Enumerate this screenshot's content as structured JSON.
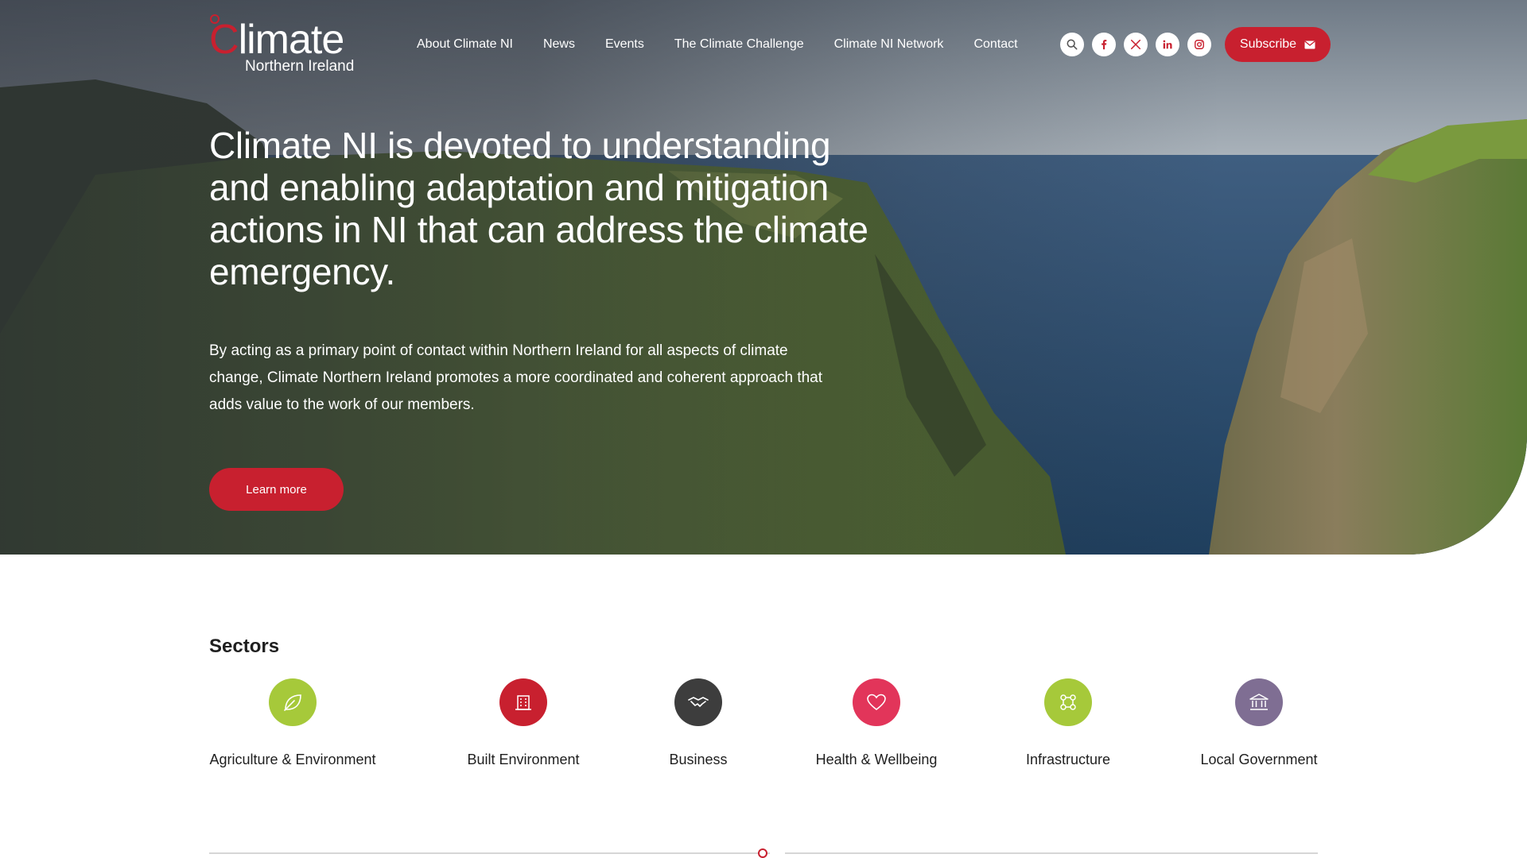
{
  "header": {
    "logo": {
      "main": "Climate",
      "sub": "Northern Ireland"
    },
    "nav": [
      "About Climate NI",
      "News",
      "Events",
      "The Climate Challenge",
      "Climate NI Network",
      "Contact"
    ],
    "icons": [
      "search-icon",
      "facebook-icon",
      "x-icon",
      "linkedin-icon",
      "instagram-icon"
    ],
    "subscribe_label": "Subscribe",
    "subscribe_icon": "envelope-icon"
  },
  "hero": {
    "headline": "Climate NI is devoted to understanding and enabling adaptation and mitigation actions in NI that can address the climate emergency.",
    "lead": "By acting as a primary point of contact within Northern Ireland for all aspects of climate change, Climate Northern Ireland promotes a more coordinated and coherent approach that adds value to the work of our members.",
    "cta_label": "Learn more"
  },
  "sectors": {
    "title": "Sectors",
    "items": [
      {
        "label": "Agriculture & Environment",
        "icon": "leaf-icon",
        "color": "#a6c93a"
      },
      {
        "label": "Built Environment",
        "icon": "building-icon",
        "color": "#c8202f"
      },
      {
        "label": "Business",
        "icon": "handshake-icon",
        "color": "#3d3d3d"
      },
      {
        "label": "Health & Wellbeing",
        "icon": "heart-icon",
        "color": "#e2355a"
      },
      {
        "label": "Infrastructure",
        "icon": "network-icon",
        "color": "#a6c93a"
      },
      {
        "label": "Local Government",
        "icon": "bank-icon",
        "color": "#7f6e93"
      }
    ]
  },
  "colors": {
    "accent": "#c8202f",
    "text": "#1f1f1f",
    "divider": "#d6d6d6"
  }
}
